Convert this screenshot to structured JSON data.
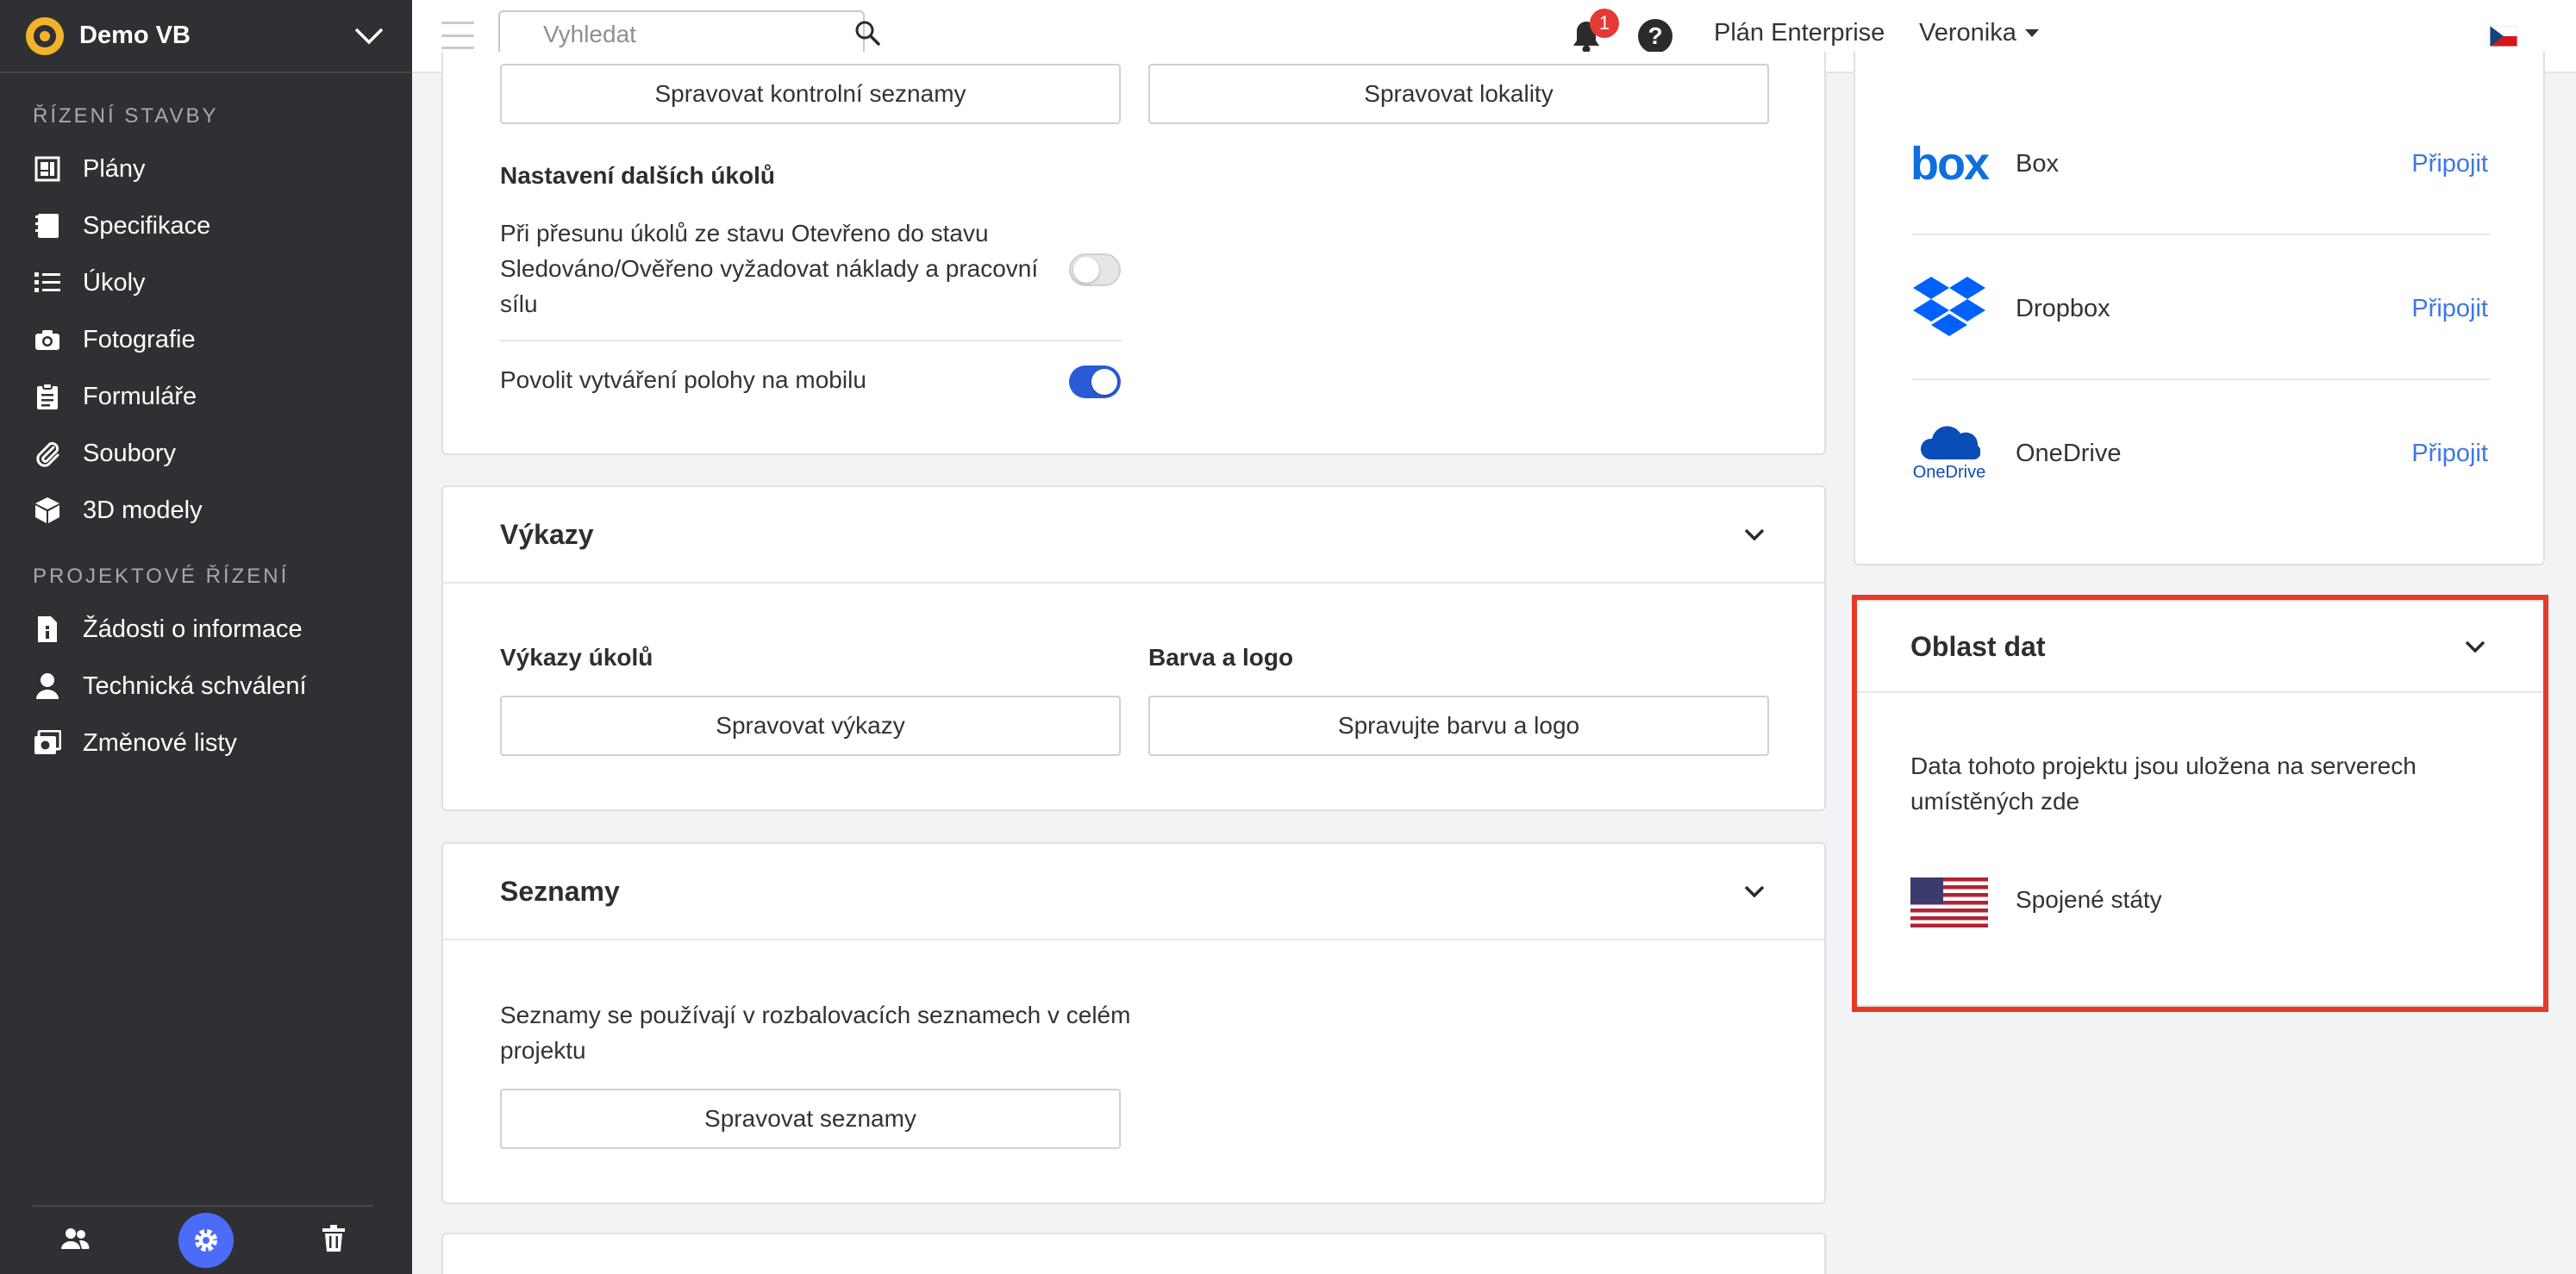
{
  "sidebar": {
    "project": "Demo VB",
    "section1": "ŘÍZENÍ STAVBY",
    "items1": [
      {
        "label": "Plány",
        "icon": "plans-icon"
      },
      {
        "label": "Specifikace",
        "icon": "specifications-icon"
      },
      {
        "label": "Úkoly",
        "icon": "tasks-list-icon"
      },
      {
        "label": "Fotografie",
        "icon": "camera-icon"
      },
      {
        "label": "Formuláře",
        "icon": "forms-clipboard-icon"
      },
      {
        "label": "Soubory",
        "icon": "paperclip-icon"
      },
      {
        "label": "3D modely",
        "icon": "cube-icon"
      }
    ],
    "section2": "PROJEKTOVÉ ŘÍZENÍ",
    "items2": [
      {
        "label": "Žádosti o informace",
        "icon": "rfi-icon"
      },
      {
        "label": "Technická schválení",
        "icon": "submittal-person-icon"
      },
      {
        "label": "Změnové listy",
        "icon": "change-order-icon"
      }
    ]
  },
  "topbar": {
    "search_placeholder": "Vyhledat",
    "notification_count": "1",
    "help_glyph": "?",
    "plan": "Plán Enterprise",
    "user": "Veronika",
    "language_flag": "cz"
  },
  "tasks_card": {
    "btn_checklists": "Spravovat kontrolní seznamy",
    "btn_locations": "Spravovat lokality",
    "more_settings_title": "Nastavení dalších úkolů",
    "setting1": "Při přesunu úkolů ze stavu Otevřeno do stavu Sledováno/Ověřeno vyžadovat náklady a pracovní sílu",
    "setting1_enabled": false,
    "setting2": "Povolit vytváření polohy na mobilu",
    "setting2_enabled": true
  },
  "reports_card": {
    "title": "Výkazy",
    "task_reports_label": "Výkazy úkolů",
    "task_reports_btn": "Spravovat výkazy",
    "color_logo_label": "Barva a logo",
    "color_logo_btn": "Spravujte barvu a logo"
  },
  "lists_card": {
    "title": "Seznamy",
    "description": "Seznamy se používají v rozbalovacích seznamech v celém projektu",
    "btn": "Spravovat seznamy"
  },
  "integrations": {
    "connect_label": "Připojit",
    "services": [
      {
        "name": "Box",
        "logo_text": "box"
      },
      {
        "name": "Dropbox"
      },
      {
        "name": "OneDrive",
        "logo_text": "OneDrive"
      }
    ]
  },
  "data_region": {
    "title": "Oblast dat",
    "description": "Data tohoto projektu jsou uložena na serverech umístěných zde",
    "region": "Spojené státy"
  },
  "colors": {
    "sidebar_bg": "#2f3033",
    "accent_blue": "#2a5bd7",
    "link_blue": "#3f77e4",
    "highlight_red": "#e53a25"
  }
}
